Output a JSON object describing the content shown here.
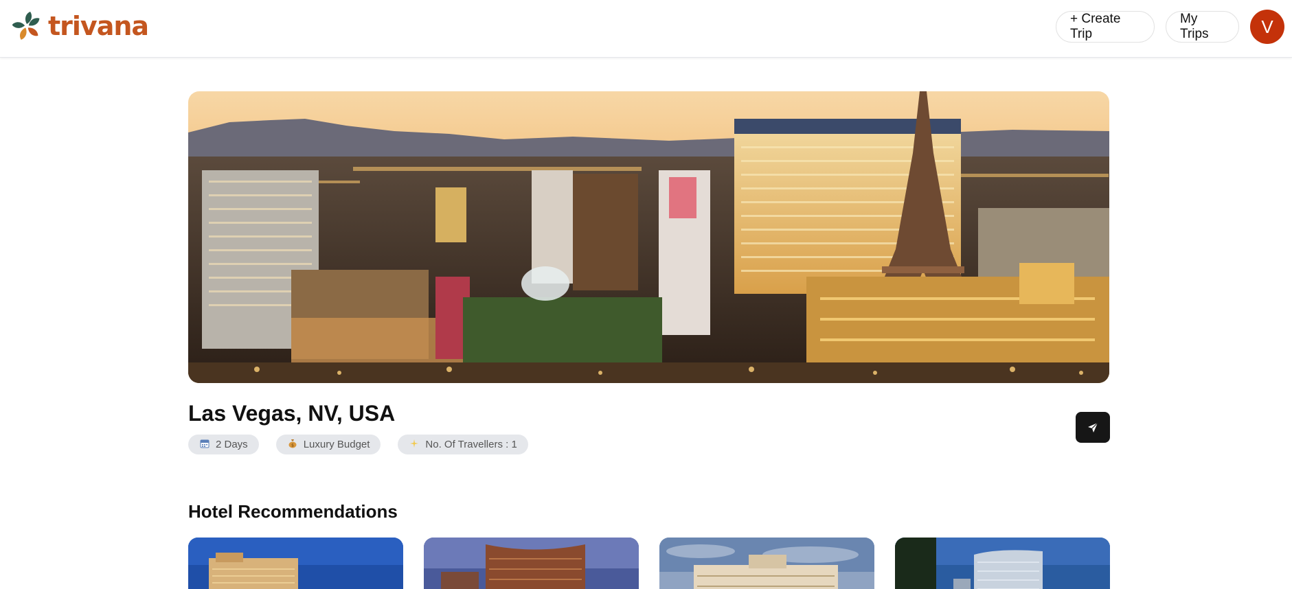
{
  "app": {
    "name": "trivana",
    "brand_color": "#c4561f",
    "icon": "trivana-logo-icon"
  },
  "header": {
    "create_trip_label": "+ Create Trip",
    "my_trips_label": "My Trips",
    "avatar_initial": "V",
    "avatar_color": "#c4320a"
  },
  "trip": {
    "destination": "Las Vegas, NV, USA",
    "chips": [
      {
        "icon": "calendar-icon",
        "label": "2 Days"
      },
      {
        "icon": "money-bag-icon",
        "label": "Luxury Budget"
      },
      {
        "icon": "sparkle-icon",
        "label": "No. Of Travellers : 1"
      }
    ],
    "share_icon": "send-icon"
  },
  "hotels": {
    "title": "Hotel Recommendations"
  }
}
